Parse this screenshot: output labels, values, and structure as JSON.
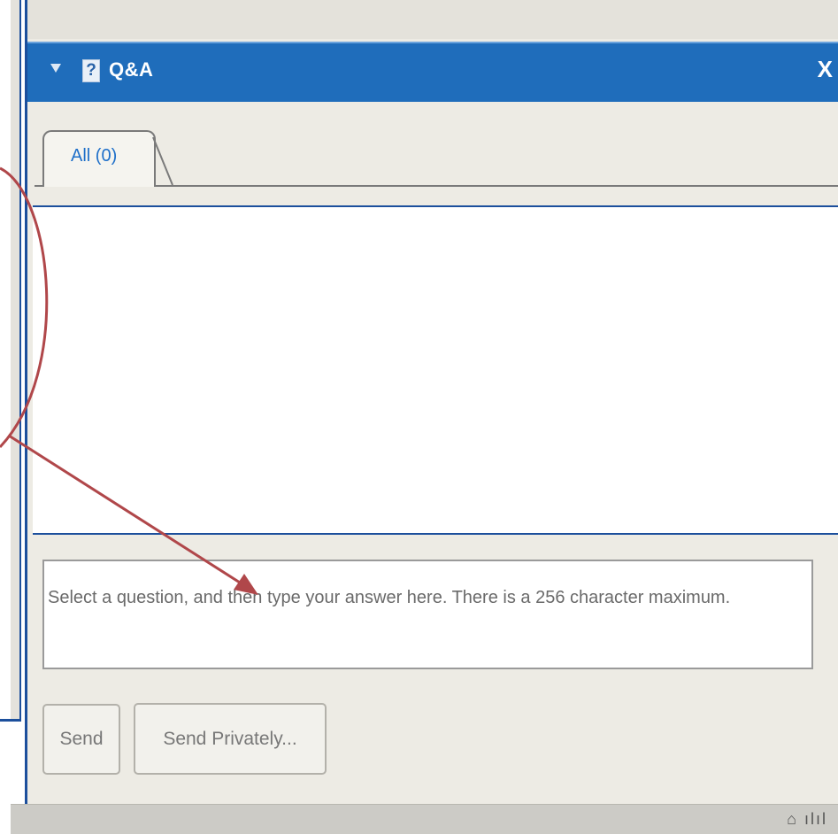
{
  "panel": {
    "title": "Q&A",
    "help_icon_glyph": "?",
    "close_glyph": "X"
  },
  "tabs": [
    {
      "label": "All (0)",
      "selected": true
    }
  ],
  "answer_input": {
    "placeholder": "Select a question, and then type your answer here. There is a 256 character maximum.",
    "value": ""
  },
  "buttons": {
    "send": "Send",
    "send_privately": "Send Privately..."
  },
  "colors": {
    "header": "#1f6dbb",
    "tab_label": "#1e6fc9",
    "annotation": "#b0474a"
  }
}
